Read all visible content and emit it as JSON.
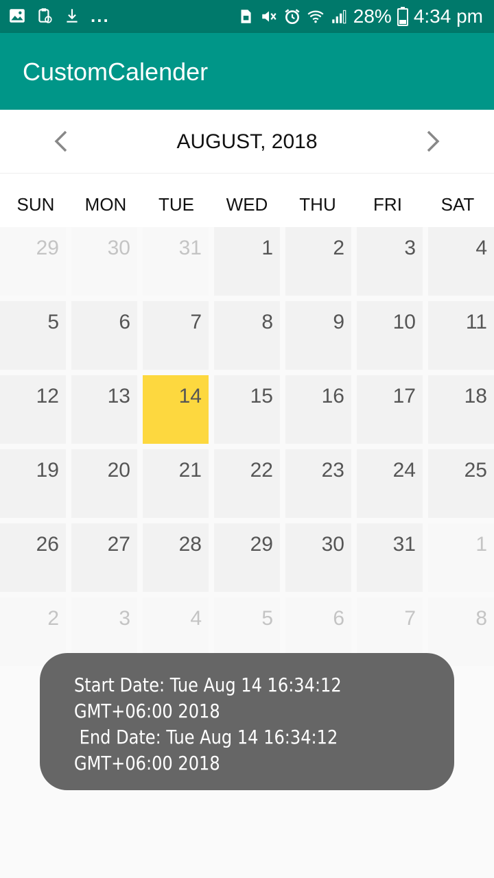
{
  "status_bar": {
    "left_icons": [
      "image-icon",
      "clipboard-icon",
      "download-icon"
    ],
    "dots": "...",
    "battery_percent": "28%",
    "time": "4:34 pm"
  },
  "app_bar": {
    "title": "CustomCalender"
  },
  "calendar": {
    "month_label": "AUGUST, 2018",
    "weekdays": [
      "SUN",
      "MON",
      "TUE",
      "WED",
      "THU",
      "FRI",
      "SAT"
    ],
    "selected_day": "14",
    "weeks": [
      [
        {
          "d": "29",
          "m": "other"
        },
        {
          "d": "30",
          "m": "other"
        },
        {
          "d": "31",
          "m": "other"
        },
        {
          "d": "1",
          "m": "current"
        },
        {
          "d": "2",
          "m": "current"
        },
        {
          "d": "3",
          "m": "current"
        },
        {
          "d": "4",
          "m": "current"
        }
      ],
      [
        {
          "d": "5",
          "m": "current"
        },
        {
          "d": "6",
          "m": "current"
        },
        {
          "d": "7",
          "m": "current"
        },
        {
          "d": "8",
          "m": "current"
        },
        {
          "d": "9",
          "m": "current"
        },
        {
          "d": "10",
          "m": "current"
        },
        {
          "d": "11",
          "m": "current"
        }
      ],
      [
        {
          "d": "12",
          "m": "current"
        },
        {
          "d": "13",
          "m": "current"
        },
        {
          "d": "14",
          "m": "selected"
        },
        {
          "d": "15",
          "m": "current"
        },
        {
          "d": "16",
          "m": "current"
        },
        {
          "d": "17",
          "m": "current"
        },
        {
          "d": "18",
          "m": "current"
        }
      ],
      [
        {
          "d": "19",
          "m": "current"
        },
        {
          "d": "20",
          "m": "current"
        },
        {
          "d": "21",
          "m": "current"
        },
        {
          "d": "22",
          "m": "current"
        },
        {
          "d": "23",
          "m": "current"
        },
        {
          "d": "24",
          "m": "current"
        },
        {
          "d": "25",
          "m": "current"
        }
      ],
      [
        {
          "d": "26",
          "m": "current"
        },
        {
          "d": "27",
          "m": "current"
        },
        {
          "d": "28",
          "m": "current"
        },
        {
          "d": "29",
          "m": "current"
        },
        {
          "d": "30",
          "m": "current"
        },
        {
          "d": "31",
          "m": "current"
        },
        {
          "d": "1",
          "m": "other"
        }
      ],
      [
        {
          "d": "2",
          "m": "other"
        },
        {
          "d": "3",
          "m": "other"
        },
        {
          "d": "4",
          "m": "other"
        },
        {
          "d": "5",
          "m": "other"
        },
        {
          "d": "6",
          "m": "other"
        },
        {
          "d": "7",
          "m": "other"
        },
        {
          "d": "8",
          "m": "other"
        }
      ]
    ]
  },
  "toast": {
    "text": "Start Date: Tue Aug 14 16:34:12\nGMT+06:00 2018\n End Date: Tue Aug 14 16:34:12\nGMT+06:00 2018"
  },
  "colors": {
    "status_bar": "#00796b",
    "app_bar": "#009688",
    "current_cell": "#f2f2f2",
    "other_cell": "#f8f8f8",
    "selected_cell": "#fdd83f",
    "current_text": "#555555",
    "other_text": "#c4c4c4",
    "toast_bg": "#666666"
  }
}
